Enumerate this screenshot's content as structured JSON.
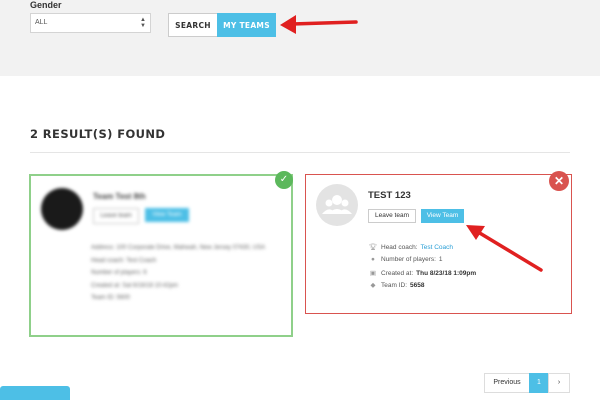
{
  "filters": {
    "gender_label": "Gender",
    "gender_value": "ALL"
  },
  "tabs": {
    "search": "SEARCH",
    "my_teams": "MY TEAMS"
  },
  "results": {
    "title": "2 RESULT(S) FOUND"
  },
  "blurred_card": {
    "title": "Team Test 8th",
    "leave_label": "Leave team",
    "view_label": "View Team",
    "lines": [
      "Address: 100 Corporate Drive, Mahwah, New Jersey 07430, USA",
      "Head coach: Test Coach",
      "Number of players: 6",
      "Created at: Sat 6/16/18 10:42pm",
      "Team ID: 5600"
    ]
  },
  "team_card": {
    "name": "TEST 123",
    "leave_label": "Leave team",
    "view_label": "View Team",
    "head_coach_label": "Head coach:",
    "head_coach_value": "Test Coach",
    "players_label": "Number of players:",
    "players_value": "1",
    "created_label": "Created at:",
    "created_value": "Thu 8/23/18 1:09pm",
    "team_id_label": "Team ID:",
    "team_id_value": "5658"
  },
  "pagination": {
    "previous": "Previous",
    "current": "1",
    "next": "›"
  },
  "icons": {
    "check": "check-icon",
    "close": "close-icon",
    "group": "group-icon",
    "trophy": "trophy-icon",
    "person": "person-icon",
    "calendar": "calendar-icon",
    "tag": "tag-icon"
  },
  "colors": {
    "accent": "#4dbfe6",
    "danger": "#d9534f",
    "success": "#5cb85c",
    "link": "#2a9fd6",
    "arrow": "#e02020"
  }
}
